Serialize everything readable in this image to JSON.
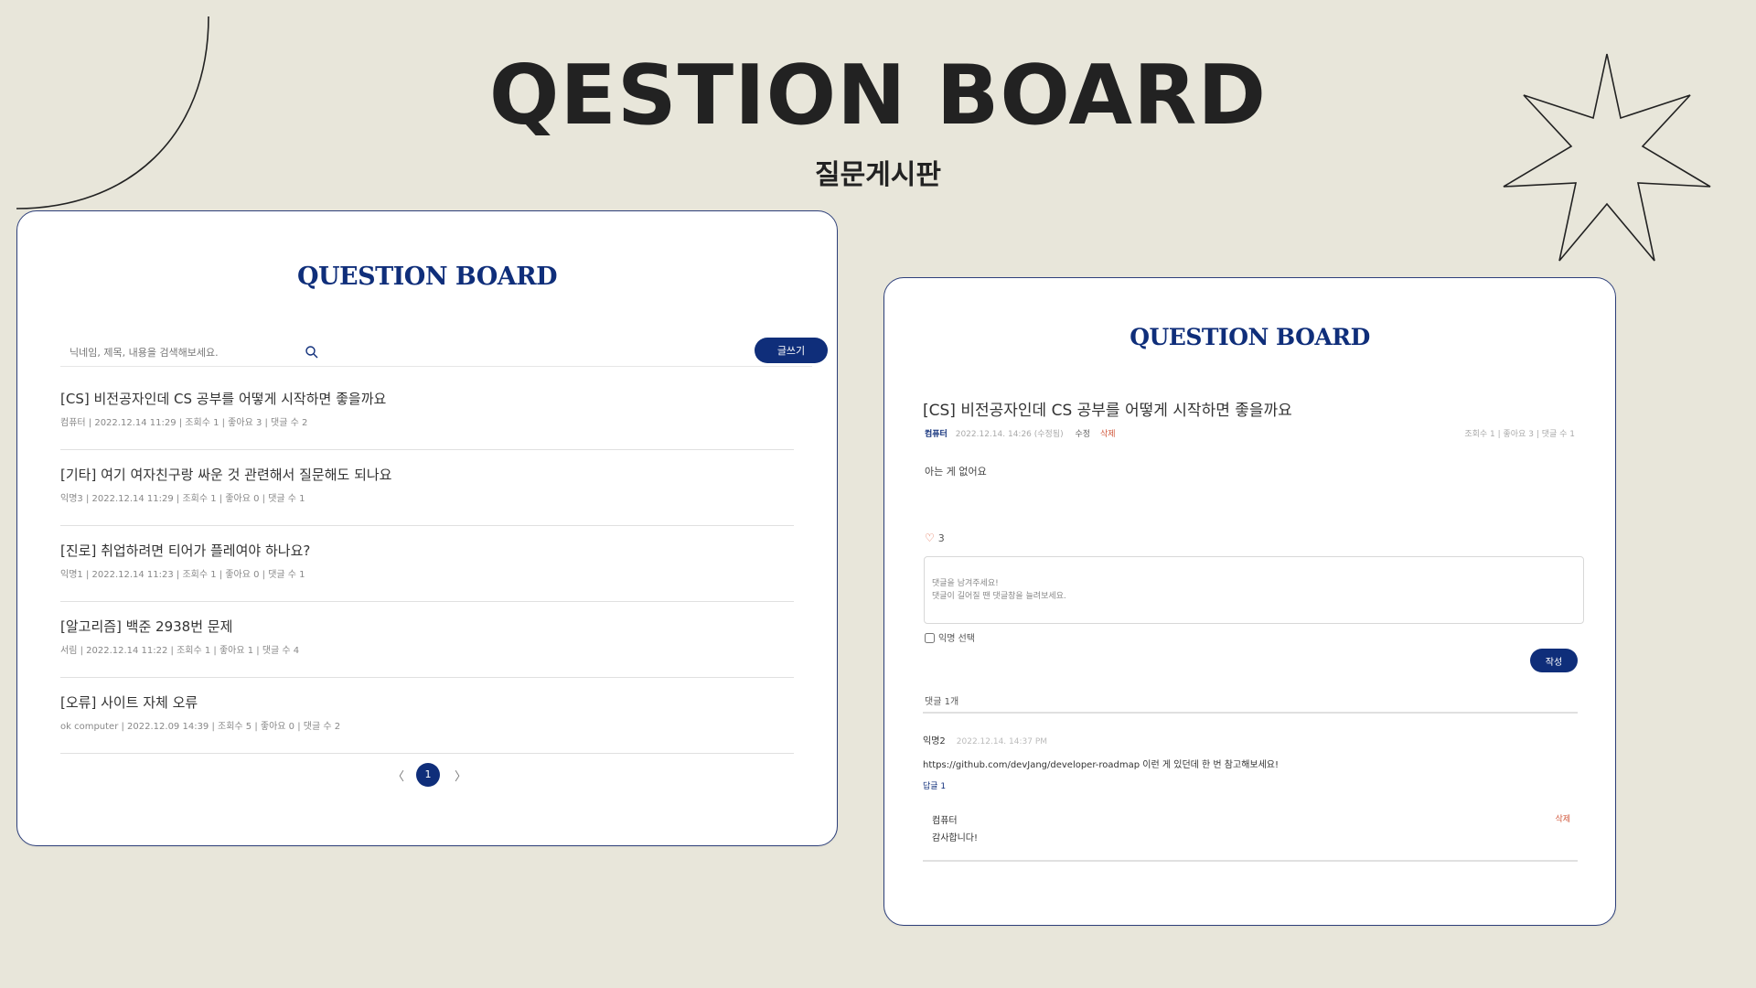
{
  "page": {
    "title": "QESTION BOARD",
    "subtitle": "질문게시판"
  },
  "list_view": {
    "logo": "QUESTION BOARD",
    "search_placeholder": "닉네임, 제목, 내용을 검색해보세요.",
    "write_label": "글쓰기",
    "posts": [
      {
        "title": "[CS] 비전공자인데 CS 공부를 어떻게 시작하면 좋을까요",
        "meta": "컴퓨터  |  2022.12.14 11:29  |  조회수 1  |  좋아요 3  |  댓글 수 2"
      },
      {
        "title": "[기타] 여기 여자친구랑 싸운 것 관련해서 질문해도 되나요",
        "meta": "익명3  |  2022.12.14 11:29  |  조회수 1  |  좋아요 0  |  댓글 수 1"
      },
      {
        "title": "[진로] 취업하려면 티어가 플레여야 하나요?",
        "meta": "익명1  |  2022.12.14 11:23  |  조회수 1  |  좋아요 0  |  댓글 수 1"
      },
      {
        "title": "[알고리즘] 백준 2938번 문제",
        "meta": "서림  |  2022.12.14 11:22  |  조회수 1  |  좋아요 1  |  댓글 수 4"
      },
      {
        "title": "[오류] 사이트 자체 오류",
        "meta": "ok computer  |  2022.12.09 14:39  |  조회수 5  |  좋아요 0  |  댓글 수 2"
      }
    ],
    "pagination": {
      "prev": "〈",
      "current": "1",
      "next": "〉"
    }
  },
  "detail_view": {
    "logo": "QUESTION BOARD",
    "title": "[CS] 비전공자인데 CS 공부를 어떻게 시작하면 좋을까요",
    "author": "컴퓨터",
    "date": "2022.12.14. 14:26 (수정됨)",
    "edit_label": "수정",
    "delete_label": "삭제",
    "stats": "조회수 1  |  좋아요 3  |  댓글 수 1",
    "body": "아는 게 없어요",
    "like_count": "3",
    "comment_placeholder": "댓글을 남겨주세요!\n댓글이 길어질 땐 댓글창을 늘려보세요.",
    "anonymous_label": "익명 선택",
    "submit_label": "작성",
    "comment_count": "댓글 1개",
    "comment": {
      "author": "익명2",
      "time": "2022.12.14. 14:37 PM",
      "text": "https://github.com/devJang/developer-roadmap 이런 게 있던데 한 번 참고해보세요!",
      "reply_link": "답글  1"
    },
    "reply": {
      "author": "컴퓨터",
      "text": "감사합니다!",
      "delete_label": "삭제"
    }
  },
  "colors": {
    "background": "#e8e6da",
    "accent": "#0f2e7a",
    "delete": "#d0563a"
  }
}
